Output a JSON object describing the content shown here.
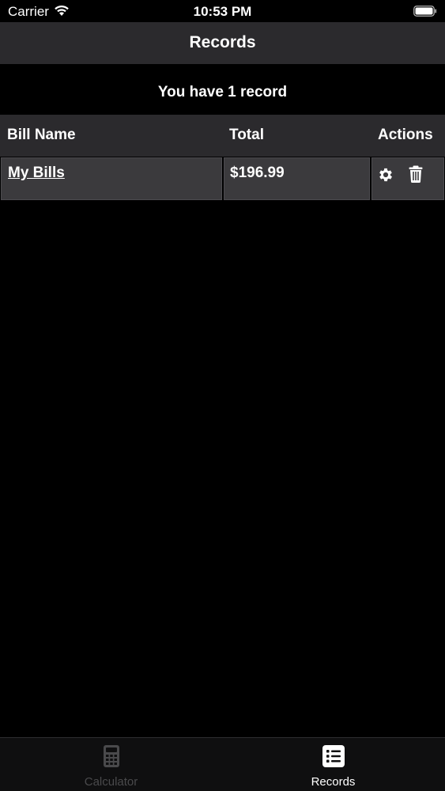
{
  "status_bar": {
    "carrier": "Carrier",
    "time": "10:53 PM"
  },
  "nav": {
    "title": "Records"
  },
  "summary": "You have 1 record",
  "table": {
    "headers": [
      "Bill Name",
      "Total",
      "Actions"
    ],
    "rows": [
      {
        "name": "My Bills",
        "total": "$196.99"
      }
    ]
  },
  "tab_bar": {
    "tabs": [
      {
        "label": "Calculator",
        "icon": "calculator-icon",
        "active": false
      },
      {
        "label": "Records",
        "icon": "list-icon",
        "active": true
      }
    ]
  },
  "colors": {
    "background": "#000000",
    "bar": "#2b2a2d",
    "cell": "#3b3a3d",
    "inactive_tab": "#4a4a4c",
    "text": "#ffffff"
  }
}
